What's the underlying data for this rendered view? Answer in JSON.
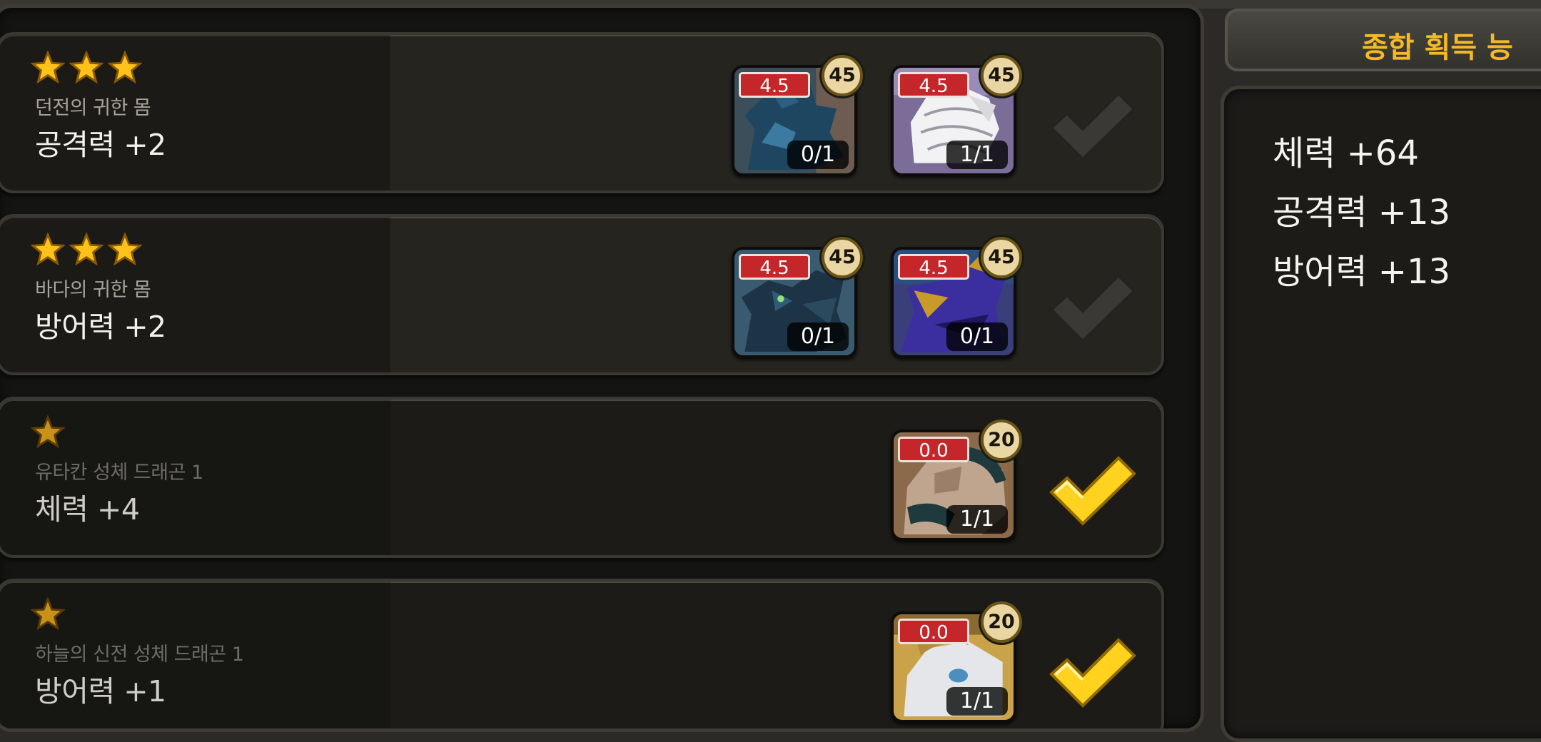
{
  "summary": {
    "title": "종합 획득 능",
    "stats": [
      "체력 +64",
      "공격력 +13",
      "방어력 +13"
    ]
  },
  "collections": [
    {
      "stars": 3,
      "name": "던전의 귀한 몸",
      "bonus": "공격력 +2",
      "completed": false,
      "cards": [
        {
          "art": "blue-dragon-icon",
          "grade": "4.5",
          "level": "45",
          "count": "0/1"
        },
        {
          "art": "white-dragon-icon",
          "grade": "4.5",
          "level": "45",
          "count": "1/1"
        }
      ]
    },
    {
      "stars": 3,
      "name": "바다의 귀한 몸",
      "bonus": "방어력 +2",
      "completed": false,
      "cards": [
        {
          "art": "sea-dragon-icon",
          "grade": "4.5",
          "level": "45",
          "count": "0/1"
        },
        {
          "art": "purple-dragon-icon",
          "grade": "4.5",
          "level": "45",
          "count": "0/1"
        }
      ]
    },
    {
      "stars": 1,
      "name": "유타칸 성체 드래곤 1",
      "bonus": "체력 +4",
      "completed": true,
      "cards": [
        {
          "art": "yutakan-dragon-icon",
          "grade": "0.0",
          "level": "20",
          "count": "1/1"
        }
      ]
    },
    {
      "stars": 1,
      "name": "하늘의 신전 성체 드래곤 1",
      "bonus": "방어력 +1",
      "completed": true,
      "cards": [
        {
          "art": "sky-temple-dragon-icon",
          "grade": "0.0",
          "level": "20",
          "count": "1/1"
        }
      ]
    }
  ],
  "colors": {
    "star": "#ffc21a",
    "check_active": "#ffd21f",
    "check_inactive": "#3a3935",
    "grade_badge": "#c4262a",
    "title": "#f5b928"
  }
}
